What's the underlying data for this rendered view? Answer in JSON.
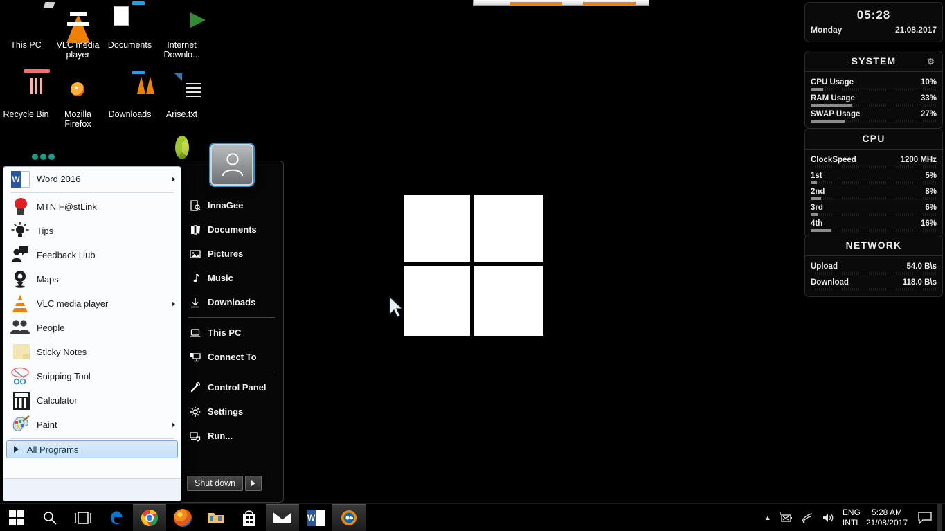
{
  "desktop": {
    "icons": [
      {
        "label": "This PC",
        "icon": "this-pc-icon"
      },
      {
        "label": "VLC media player",
        "icon": "vlc-cone-icon"
      },
      {
        "label": "Documents",
        "icon": "documents-folder-icon"
      },
      {
        "label": "Internet Downlo...",
        "icon": "internet-download-manager-icon"
      },
      {
        "label": "Recycle Bin",
        "icon": "recycle-bin-icon"
      },
      {
        "label": "Mozilla Firefox",
        "icon": "firefox-icon"
      },
      {
        "label": "Downloads",
        "icon": "downloads-folder-icon"
      },
      {
        "label": "Arise.txt",
        "icon": "text-file-icon"
      },
      {
        "label": "",
        "icon": "gear-tool-icon"
      },
      {
        "label": "",
        "icon": "wrench-tools-icon"
      },
      {
        "label": "",
        "icon": "blue-folder-icon"
      },
      {
        "label": "",
        "icon": "green-ring-icon"
      }
    ]
  },
  "start_menu": {
    "left_items": [
      {
        "label": "Word 2016",
        "icon": "word-icon",
        "has_submenu": true
      },
      {
        "label": "MTN F@stLink",
        "icon": "mtn-fastlink-icon",
        "has_submenu": false
      },
      {
        "label": "Tips",
        "icon": "lightbulb-icon",
        "has_submenu": false
      },
      {
        "label": "Feedback Hub",
        "icon": "feedback-hub-icon",
        "has_submenu": false
      },
      {
        "label": "Maps",
        "icon": "maps-pin-icon",
        "has_submenu": false
      },
      {
        "label": "VLC media player",
        "icon": "vlc-cone-icon",
        "has_submenu": true
      },
      {
        "label": "People",
        "icon": "people-icon",
        "has_submenu": false
      },
      {
        "label": "Sticky Notes",
        "icon": "sticky-notes-icon",
        "has_submenu": false
      },
      {
        "label": "Snipping Tool",
        "icon": "snipping-tool-icon",
        "has_submenu": false
      },
      {
        "label": "Calculator",
        "icon": "calculator-icon",
        "has_submenu": false
      },
      {
        "label": "Paint",
        "icon": "paint-palette-icon",
        "has_submenu": true
      }
    ],
    "all_programs_label": "All Programs",
    "right_items": [
      {
        "label": "InnaGee",
        "icon": "user-folder-icon"
      },
      {
        "label": "Documents",
        "icon": "documents-icon"
      },
      {
        "label": "Pictures",
        "icon": "pictures-icon"
      },
      {
        "label": "Music",
        "icon": "music-note-icon"
      },
      {
        "label": "Downloads",
        "icon": "download-arrow-icon"
      },
      {
        "label": "This PC",
        "icon": "computer-icon"
      },
      {
        "label": "Connect To",
        "icon": "connect-to-icon"
      },
      {
        "label": "Control Panel",
        "icon": "control-panel-icon"
      },
      {
        "label": "Settings",
        "icon": "gear-icon"
      },
      {
        "label": "Run...",
        "icon": "run-icon"
      }
    ],
    "shutdown_label": "Shut down",
    "avatar_name": "user-avatar"
  },
  "sidebar": {
    "clock": {
      "time": "05:28",
      "day": "Monday",
      "date": "21.08.2017"
    },
    "system": {
      "title": "SYSTEM",
      "rows": [
        {
          "label": "CPU Usage",
          "value": "10%",
          "pct": 10
        },
        {
          "label": "RAM Usage",
          "value": "33%",
          "pct": 33
        },
        {
          "label": "SWAP Usage",
          "value": "27%",
          "pct": 27
        }
      ]
    },
    "cpu": {
      "title": "CPU",
      "rows": [
        {
          "label": "ClockSpeed",
          "value": "1200 MHz",
          "pct": 0
        },
        {
          "label": "1st",
          "value": "5%",
          "pct": 5
        },
        {
          "label": "2nd",
          "value": "8%",
          "pct": 8
        },
        {
          "label": "3rd",
          "value": "6%",
          "pct": 6
        },
        {
          "label": "4th",
          "value": "16%",
          "pct": 16
        }
      ]
    },
    "network": {
      "title": "NETWORK",
      "rows": [
        {
          "label": "Upload",
          "value": "54.0 B\\s",
          "pct": 0
        },
        {
          "label": "Download",
          "value": "118.0 B\\s",
          "pct": 0
        }
      ]
    }
  },
  "taskbar": {
    "buttons": [
      {
        "name": "start-button",
        "icon": "windows-logo-icon",
        "active": false
      },
      {
        "name": "search-button",
        "icon": "search-icon",
        "active": false
      },
      {
        "name": "task-view-button",
        "icon": "task-view-icon",
        "active": false
      },
      {
        "name": "edge-button",
        "icon": "edge-icon",
        "active": false
      },
      {
        "name": "chrome-button",
        "icon": "chrome-icon",
        "active": true
      },
      {
        "name": "firefox-button",
        "icon": "firefox-icon",
        "active": false
      },
      {
        "name": "file-explorer-button",
        "icon": "folder-icon",
        "active": false
      },
      {
        "name": "store-button",
        "icon": "store-icon",
        "active": false
      },
      {
        "name": "mail-button",
        "icon": "mail-icon",
        "active": true
      },
      {
        "name": "word-button",
        "icon": "word-icon",
        "active": false
      },
      {
        "name": "camera-button",
        "icon": "camera-icon",
        "active": true
      }
    ],
    "tray": {
      "show_hidden": "show-hidden-icons",
      "battery": "battery-icon",
      "network": "wifi-icon",
      "volume": "volume-icon"
    },
    "language_line1": "ENG",
    "language_line2": "INTL",
    "clock_time": "5:28 AM",
    "clock_date": "21/08/2017",
    "action_center": "action-center-icon"
  },
  "colors": {
    "accent": "#2a8fc9",
    "taskbar_bg": "#000000",
    "menu_left_bg": "#fafcfe",
    "highlight": "#c4e0f7"
  }
}
